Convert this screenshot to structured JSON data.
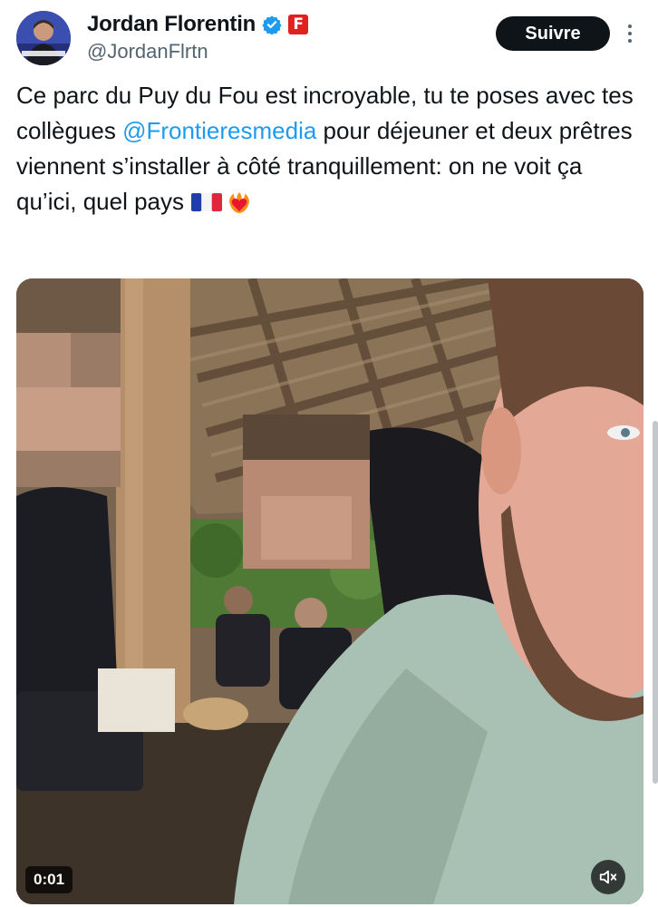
{
  "author": {
    "name": "Jordan Florentin",
    "handle": "@JordanFlrtn",
    "affiliate_badge_letter": "F",
    "verified_color": "#1d9bf0",
    "affiliate_color": "#e0211d"
  },
  "follow_label": "Suivre",
  "tweet": {
    "text_part1": "Ce parc du Puy du Fou est incroyable, tu te poses avec tes collègues ",
    "mention": "@Frontieresmedia",
    "text_part2": " pour déjeuner et deux prêtres viennent s’installer à côté tranquillement: on ne voit ça qu’ici, quel pays ",
    "emojis": [
      "french-flag-emoji",
      "heart-on-fire-emoji"
    ]
  },
  "video": {
    "timestamp": "0:01",
    "muted": true
  },
  "colors": {
    "text": "#0f1419",
    "secondary": "#536471",
    "accent": "#1d9bf0"
  }
}
